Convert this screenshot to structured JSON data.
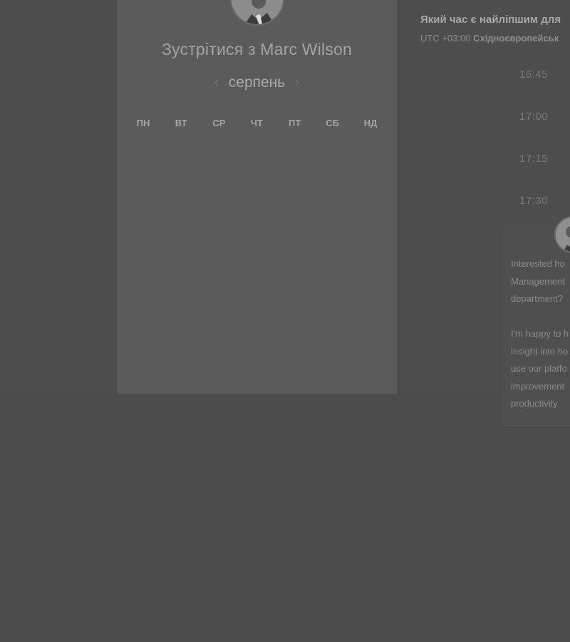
{
  "calendar": {
    "meet_title": "Зустрітися з Marc Wilson",
    "prev_icon": "chevron-left-icon",
    "next_icon": "chevron-right-icon",
    "month": "серпень",
    "weekdays": [
      "ПН",
      "ВТ",
      "СР",
      "ЧТ",
      "ПТ",
      "СБ",
      "НД"
    ]
  },
  "schedule": {
    "heading": "Який час є найліпшим для",
    "utc_offset": "UTC +03:00",
    "timezone_name": "Східноєвропейськ",
    "slots": [
      "16:45",
      "17:00",
      "17:15",
      "17:30",
      "",
      "",
      ""
    ]
  },
  "host_popup": {
    "lines": [
      "Interested ho",
      "Management",
      "department?",
      "I'm happy to h",
      "insight into ho",
      "use our platfo",
      "improvement",
      "productivity"
    ]
  }
}
